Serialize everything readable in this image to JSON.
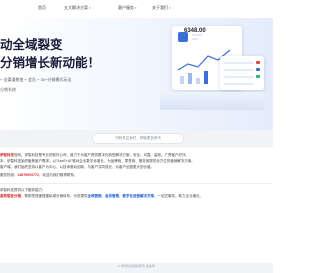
{
  "nav": {
    "items": [
      {
        "label": "首页"
      },
      {
        "label": "五大解决方案",
        "dropdown": true
      },
      {
        "label": "客户服务",
        "dropdown": true
      },
      {
        "label": "关于我们",
        "dropdown": true
      }
    ]
  },
  "hero": {
    "title_line1": "动全域裂变",
    "title_line2": "分销增长新动能！",
    "subtitle": "+ 全渠道裂变 + 会员 + 30+分销模式玩法",
    "subtitle2": "分销系统",
    "dashboard_amount": "6348.00"
  },
  "pagination": {
    "count": 3,
    "active": 0
  },
  "chip_text": "扫码关注我们，获取更多资讯",
  "content": {
    "p1_line1_lead": "伊智科技",
    "p1_line1_rest": "官网，伊智科技是专业的软件公司，致力于为客户提供数字化转型解决方案，安全、可靠、高效，广受客户好评。",
    "p1_line2": "本，伊智科技始终聚焦客户需求，以“SaaS+AI”驱动企业数字化增长，为品牌商、零售商、服务商提供全方位的营销解决方案。",
    "p1_line3": "客户端，我们始终坚持以客户为中心，以技术驱动创新，与客户共同成长，为客户创造更大的价值。",
    "phone_lead": "服务热线：",
    "phone_number": "13676009772",
    "phone_rest": "，欢迎与我们取得联系。",
    "p2_head": "伊智科技提供以下服务能力：",
    "p2_red": "高效裂变分销",
    "p2_mid": "，帮助您快速搭建私域分销体系，为您提供",
    "p2_blue": "全域营销、会员管理、数字化运营解决方案",
    "p2_tail": "，一站式服务，助力企业增长。"
  },
  "footer": {
    "text": "© 伊智科技版权所有  备案号"
  }
}
